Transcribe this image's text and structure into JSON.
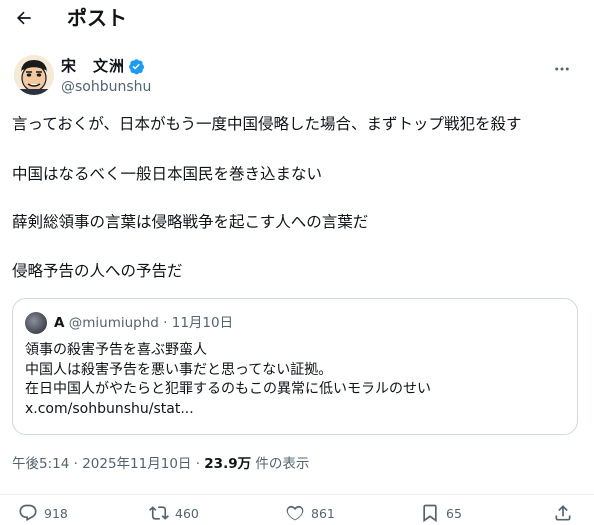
{
  "header": {
    "title": "ポスト"
  },
  "author": {
    "display_name": "宋　文洲",
    "handle": "@sohbunshu"
  },
  "post": {
    "lines": [
      "言っておくが、日本がもう一度中国侵略した場合、まずトップ戦犯を殺す",
      "中国はなるべく一般日本国民を巻き込まない",
      "薛剣総領事の言葉は侵略戦争を起こす人への言葉だ",
      "侵略予告の人への予告だ"
    ]
  },
  "quote": {
    "name": "A",
    "meta": "@miumiuphd · 11月10日",
    "lines": [
      "領事の殺害予告を喜ぶ野蛮人",
      "中国人は殺害予告を悪い事だと思ってない証拠。",
      "在日中国人がやたらと犯罪するのもこの異常に低いモラルのせい",
      "x.com/sohbunshu/stat..."
    ]
  },
  "meta": {
    "time": "午後5:14 · 2025年11月10日 · ",
    "views": "23.9万",
    "views_suffix": " 件の表示"
  },
  "actions": {
    "reply": "918",
    "repost": "460",
    "like": "861",
    "bookmark": "65"
  },
  "colors": {
    "text": "#0f1419",
    "secondary": "#536471",
    "verified": "#1d9bf0",
    "border": "#cfd9de"
  },
  "icons": [
    "back-arrow-icon",
    "verified-badge-icon",
    "more-icon",
    "reply-icon",
    "repost-icon",
    "like-icon",
    "bookmark-icon",
    "share-icon"
  ]
}
